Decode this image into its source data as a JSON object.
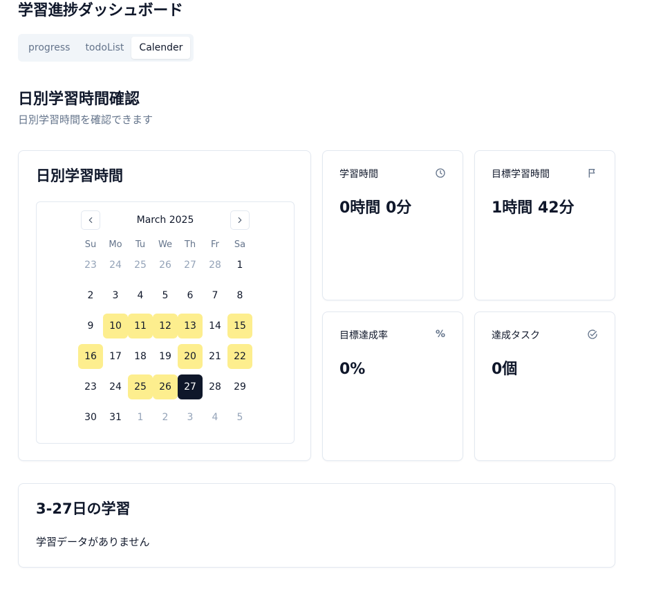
{
  "app": {
    "title": "学習進捗ダッシュボード"
  },
  "tabs": [
    {
      "label": "progress"
    },
    {
      "label": "todoList"
    },
    {
      "label": "Calender"
    }
  ],
  "section": {
    "title": "日別学習時間確認",
    "subtitle": "日別学習時間を確認できます"
  },
  "calendar_card": {
    "title": "日別学習時間",
    "month_label": "March 2025",
    "prev_icon": "chevron-left-icon",
    "next_icon": "chevron-right-icon",
    "weekdays": [
      "Su",
      "Mo",
      "Tu",
      "We",
      "Th",
      "Fr",
      "Sa"
    ],
    "weeks": [
      [
        "23",
        "24",
        "25",
        "26",
        "27",
        "28",
        "1"
      ],
      [
        "2",
        "3",
        "4",
        "5",
        "6",
        "7",
        "8"
      ],
      [
        "9",
        "10",
        "11",
        "12",
        "13",
        "14",
        "15"
      ],
      [
        "16",
        "17",
        "18",
        "19",
        "20",
        "21",
        "22"
      ],
      [
        "23",
        "24",
        "25",
        "26",
        "27",
        "28",
        "29"
      ],
      [
        "30",
        "31",
        "1",
        "2",
        "3",
        "4",
        "5"
      ]
    ],
    "studied_days": [
      "10",
      "11",
      "12",
      "13",
      "15",
      "16",
      "20",
      "22",
      "25",
      "26"
    ],
    "selected_day": "27",
    "highlight_color": "#fdee8e",
    "selected_color": "#0f172a"
  },
  "stats": {
    "study_time": {
      "label": "学習時間",
      "value": "0時間 0分",
      "icon": "clock-icon"
    },
    "target_time": {
      "label": "目標学習時間",
      "value": "1時間 42分",
      "icon": "flag-icon"
    },
    "achievement_rate": {
      "label": "目標達成率",
      "value": "0%",
      "icon": "%"
    },
    "completed_tasks": {
      "label": "達成タスク",
      "value": "0個",
      "icon": "check-circle-icon"
    }
  },
  "detail": {
    "title": "3-27日の学習",
    "empty_message": "学習データがありません"
  }
}
